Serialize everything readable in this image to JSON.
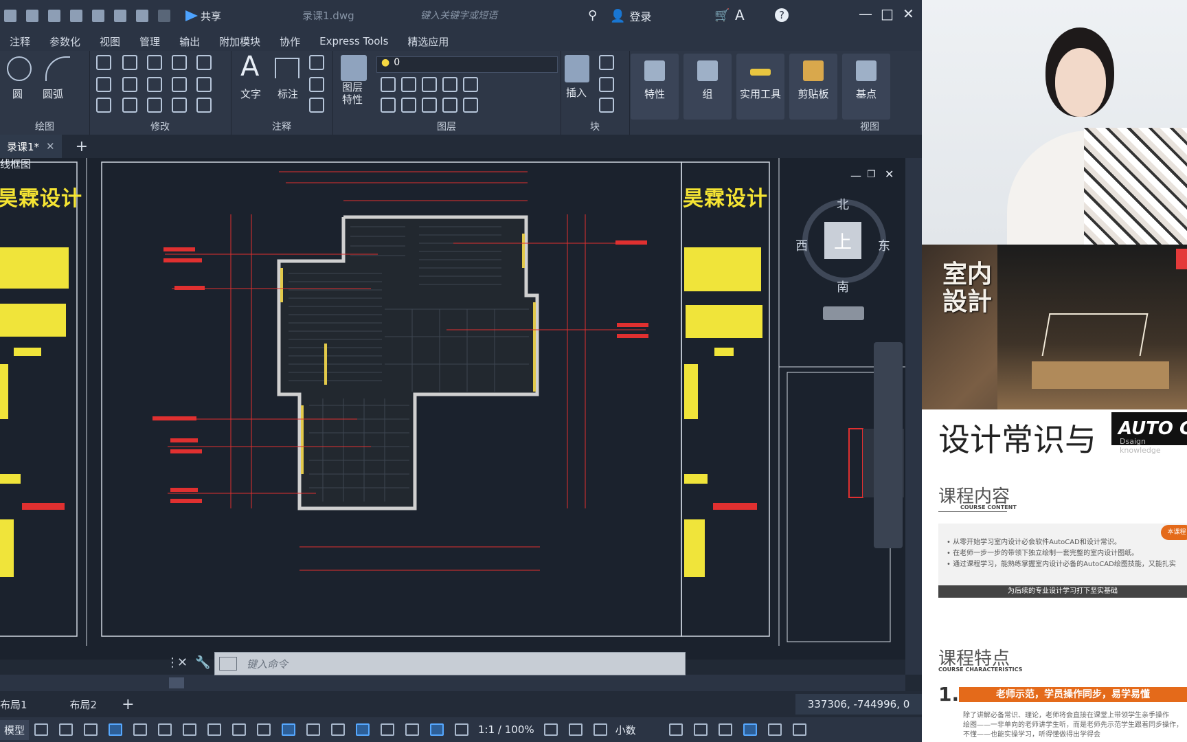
{
  "titlebar": {
    "share_label": "共享",
    "filename": "录课1.dwg",
    "search_placeholder": "键入关键字或短语",
    "login_label": "登录"
  },
  "menu": [
    "注释",
    "参数化",
    "视图",
    "管理",
    "输出",
    "附加模块",
    "协作",
    "Express Tools",
    "精选应用"
  ],
  "ribbon": {
    "draw_arc": "圆弧",
    "draw_circle": "圆",
    "text": "文字",
    "dimension": "标注",
    "layer_props": "图层\n特性",
    "layer_value": "0",
    "insert": "插入",
    "properties": "特性",
    "group": "组",
    "utilities": "实用工具",
    "clipboard": "剪贴板",
    "base": "基点",
    "panels": [
      "绘图",
      "修改",
      "注释",
      "图层",
      "块",
      "视图"
    ]
  },
  "doc_tab": "录课1*",
  "viewport_label": "线框图",
  "drawing": {
    "logo_text": "昊霖设计"
  },
  "viewcube": {
    "north": "北",
    "south": "南",
    "west": "西",
    "east": "东",
    "top": "上"
  },
  "command_placeholder": "键入命令",
  "layout_tabs": [
    "布局1",
    "布局2"
  ],
  "coords": "337306, -744996, 0",
  "status": {
    "scale": "1:1 / 100%",
    "units": "小数"
  },
  "right_panel": {
    "stamp": "室内\n設計",
    "banner_title": "设计常识与",
    "banner_tag": "AUTO C",
    "banner_sub": "Dsaign knowledge",
    "section1_title": "课程内容",
    "section1_sub": "COURSE CONTENT",
    "bullets": [
      "• 从零开始学习室内设计必会软件AutoCAD和设计常识。",
      "• 在老师一步一步的带领下独立绘制一套完整的室内设计图纸。",
      "• 通过课程学习，能熟练掌握室内设计必备的AutoCAD绘图技能，又能扎实"
    ],
    "badge": "本课程",
    "content_bar": "为后续的专业设计学习打下坚实基础",
    "section2_title": "课程特点",
    "section2_sub": "COURSE CHARACTERISTICS",
    "point_num": "1.",
    "point_bar": "老师示范，学员操作同步，易学易懂",
    "point_lines": [
      "除了讲解必备常识、理论，老师将会直接在课堂上带领学生亲手操作",
      "绘图——一非单向的老师讲学生听，而是老师先示范学生跟着同步操作，",
      "不懂——也能实操学习，听得懂做得出学得会"
    ]
  }
}
